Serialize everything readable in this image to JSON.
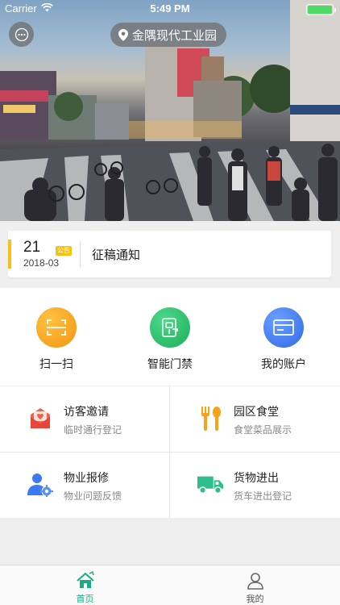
{
  "status_bar": {
    "carrier": "Carrier",
    "time": "5:49 PM"
  },
  "header": {
    "location": "金隅现代工业园"
  },
  "notice": {
    "day": "21",
    "badge": "公告",
    "month": "2018-03",
    "title": "征稿通知"
  },
  "actions": [
    {
      "label": "扫一扫",
      "icon": "scan-icon",
      "color": "#f7a21b"
    },
    {
      "label": "智能门禁",
      "icon": "door-access-icon",
      "color": "#2fbf6a"
    },
    {
      "label": "我的账户",
      "icon": "card-icon",
      "color": "#3b7af0"
    }
  ],
  "services": [
    {
      "title": "访客邀请",
      "subtitle": "临时通行登记",
      "icon": "invitation-icon",
      "color": "#f0604a"
    },
    {
      "title": "园区食堂",
      "subtitle": "食堂菜品展示",
      "icon": "cutlery-icon",
      "color": "#f7a21b"
    },
    {
      "title": "物业报修",
      "subtitle": "物业问题反馈",
      "icon": "repair-user-icon",
      "color": "#3b7af0"
    },
    {
      "title": "货物进出",
      "subtitle": "货车进出登记",
      "icon": "truck-icon",
      "color": "#2fbf8a"
    }
  ],
  "tabs": [
    {
      "label": "首页",
      "icon": "home-icon",
      "active": true
    },
    {
      "label": "我的",
      "icon": "profile-icon",
      "active": false
    }
  ],
  "colors": {
    "accent": "#1aad84",
    "notice_bar": "#f5c213"
  }
}
